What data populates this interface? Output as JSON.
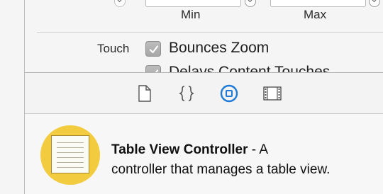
{
  "zoom": {
    "min_label": "Min",
    "max_label": "Max"
  },
  "touch": {
    "label": "Touch",
    "options": [
      {
        "label": "Bounces Zoom",
        "checked": true
      },
      {
        "label": "Delays Content Touches",
        "checked": true
      }
    ]
  },
  "library_tabs": [
    {
      "name": "file-template-library",
      "icon": "file-icon",
      "selected": false
    },
    {
      "name": "code-snippet-library",
      "icon": "braces-icon",
      "selected": false
    },
    {
      "name": "object-library",
      "icon": "circle-square-icon",
      "selected": true
    },
    {
      "name": "media-library",
      "icon": "film-strip-icon",
      "selected": false
    }
  ],
  "description": {
    "title": "Table View Controller",
    "separator": " - A",
    "body": "controller that manages a table view.",
    "icon": "table-view-controller-icon"
  },
  "colors": {
    "accent": "#1e7ad9",
    "object_icon": "#f2cb3e"
  }
}
